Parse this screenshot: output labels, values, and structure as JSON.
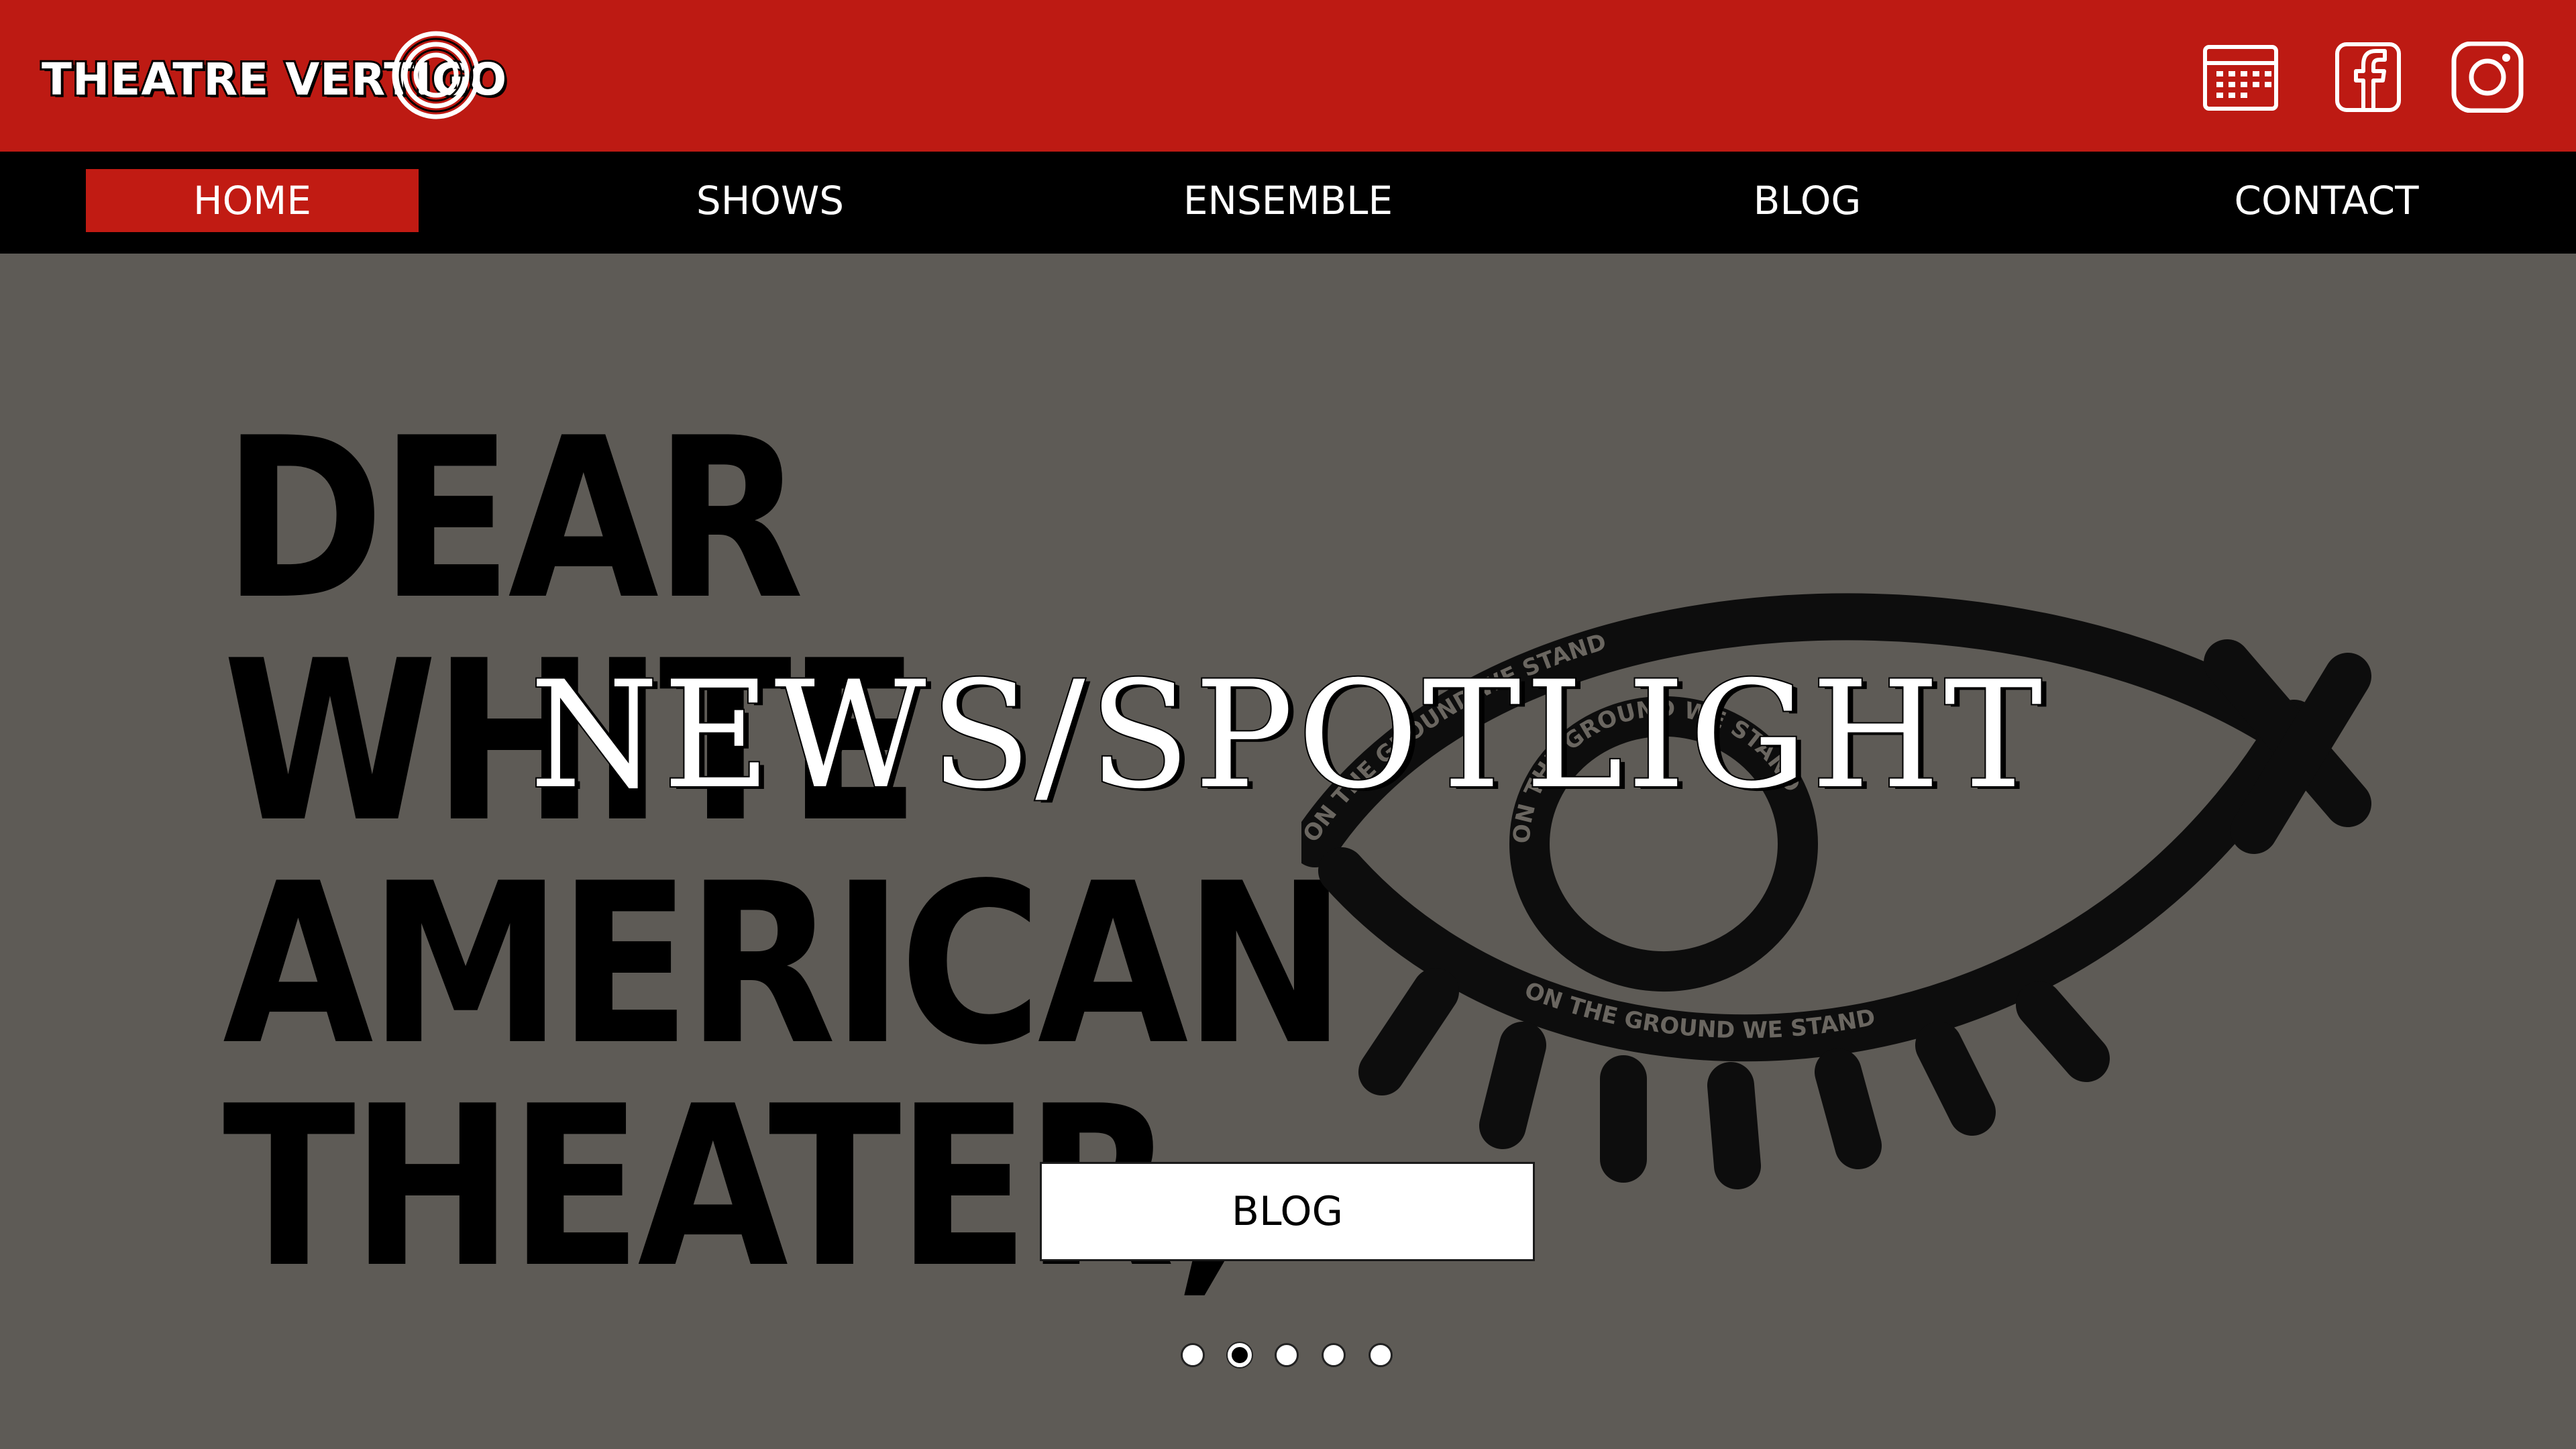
{
  "brand": {
    "logo_text": "THEATRE VERTIGO",
    "accent_color": "#bd1a13",
    "nav_bg": "#000000",
    "hero_bg": "#5e5b56"
  },
  "header": {
    "icons": [
      {
        "name": "calendar-icon"
      },
      {
        "name": "facebook-icon"
      },
      {
        "name": "instagram-icon"
      }
    ]
  },
  "nav": {
    "items": [
      {
        "label": "HOME",
        "active": true
      },
      {
        "label": "SHOWS",
        "active": false
      },
      {
        "label": "ENSEMBLE",
        "active": false
      },
      {
        "label": "BLOG",
        "active": false
      },
      {
        "label": "CONTACT",
        "active": false
      }
    ]
  },
  "hero": {
    "poster_lines": [
      "DEAR",
      "WHITE",
      "AMERICAN",
      "THEATER,"
    ],
    "poster_eye_text": "ON THE GROUND WE STAND",
    "headline": "NEWS/SPOTLIGHT",
    "cta_label": "BLOG",
    "carousel": {
      "count": 5,
      "active_index": 1
    }
  }
}
